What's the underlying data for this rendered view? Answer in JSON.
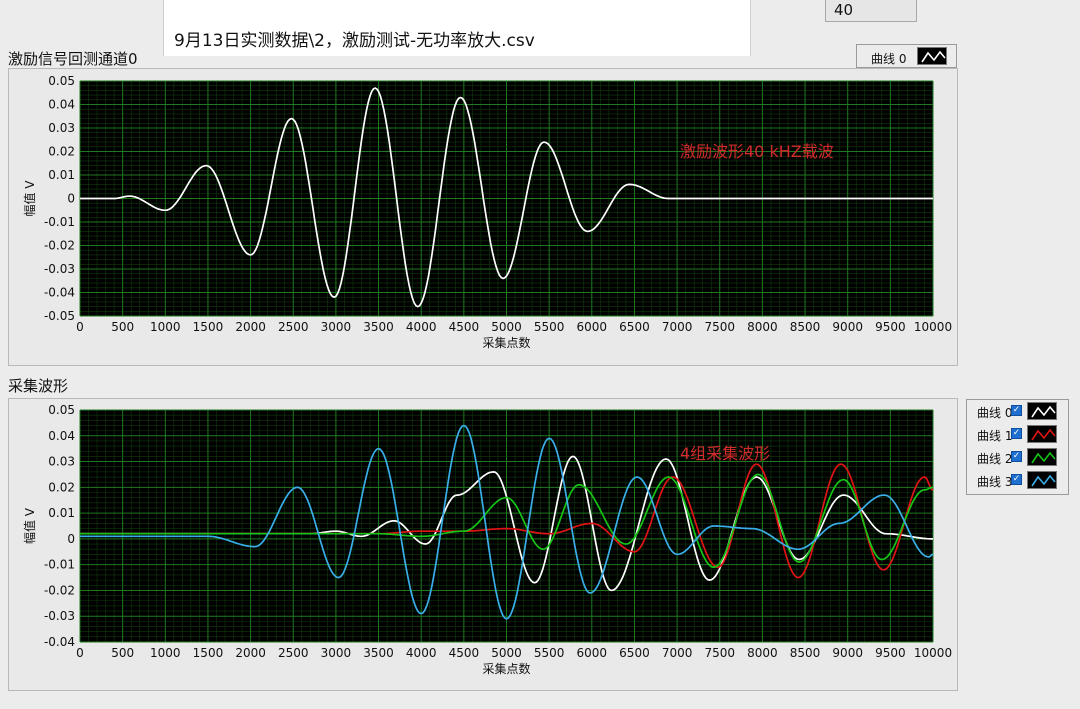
{
  "file_path": {
    "text": "9月13日实测数据\\2，激励测试-无功率放大.csv"
  },
  "numeric_control": {
    "value": "40"
  },
  "graph1": {
    "title": "激励信号回测通道0",
    "legend": [
      {
        "label": "曲线 0",
        "color": "#ffffff"
      }
    ],
    "annotation": "激励波形40 kHZ载波",
    "annotation_color": "#d22b2b"
  },
  "graph2": {
    "title": "采集波形",
    "legend": [
      {
        "label": "曲线 0",
        "color": "#ffffff"
      },
      {
        "label": "曲线 1",
        "color": "#e01414"
      },
      {
        "label": "曲线 2",
        "color": "#16c416"
      },
      {
        "label": "曲线 3",
        "color": "#3aaee8"
      }
    ],
    "annotation": "4组采集波形",
    "annotation_color": "#d22b2b"
  },
  "chart_data": [
    {
      "type": "line",
      "title": "激励信号回测通道0",
      "xlabel": "采集点数",
      "ylabel": "幅值 V",
      "xlim": [
        0,
        10000
      ],
      "ylim": [
        -0.05,
        0.05
      ],
      "x_ticks": [
        0,
        500,
        1000,
        1500,
        2000,
        2500,
        3000,
        3500,
        4000,
        4500,
        5000,
        5500,
        6000,
        6500,
        7000,
        7500,
        8000,
        8500,
        9000,
        9500,
        10000
      ],
      "y_ticks": [
        "0.05",
        "0.04",
        "0.03",
        "0.02",
        "0.01",
        "0",
        "-0.01",
        "-0.02",
        "-0.03",
        "-0.04",
        "-0.05"
      ],
      "grid": true,
      "legend_position": "top-right",
      "series": [
        {
          "name": "曲线 0",
          "color": "#ffffff",
          "x": [
            0,
            400,
            580,
            1000,
            1480,
            2000,
            2480,
            2980,
            3460,
            3960,
            4460,
            4960,
            5440,
            5950,
            6440,
            6900,
            7100,
            10000
          ],
          "y": [
            0,
            0,
            0.001,
            -0.005,
            0.014,
            -0.024,
            0.034,
            -0.042,
            0.047,
            -0.046,
            0.043,
            -0.034,
            0.024,
            -0.014,
            0.006,
            0,
            0,
            0
          ]
        }
      ]
    },
    {
      "type": "line",
      "title": "采集波形",
      "xlabel": "采集点数",
      "ylabel": "幅值 V",
      "xlim": [
        0,
        10000
      ],
      "ylim": [
        -0.04,
        0.05
      ],
      "x_ticks": [
        0,
        500,
        1000,
        1500,
        2000,
        2500,
        3000,
        3500,
        4000,
        4500,
        5000,
        5500,
        6000,
        6500,
        7000,
        7500,
        8000,
        8500,
        9000,
        9500,
        10000
      ],
      "y_ticks": [
        "0.05",
        "0.04",
        "0.03",
        "0.02",
        "0.01",
        "0",
        "-0.01",
        "-0.02",
        "-0.03",
        "-0.04"
      ],
      "grid": true,
      "legend_position": "right",
      "series": [
        {
          "name": "曲线 0",
          "color": "#ffffff",
          "x": [
            0,
            2000,
            2700,
            3000,
            3300,
            3680,
            4050,
            4420,
            4850,
            5330,
            5780,
            6230,
            6870,
            7380,
            7930,
            8430,
            8950,
            9450,
            10000
          ],
          "y": [
            0.002,
            0.002,
            0.002,
            0.003,
            0.001,
            0.007,
            -0.002,
            0.017,
            0.026,
            -0.017,
            0.032,
            -0.02,
            0.031,
            -0.016,
            0.024,
            -0.008,
            0.017,
            0.002,
            0
          ]
        },
        {
          "name": "曲线 1",
          "color": "#e01414",
          "x": [
            0,
            3500,
            4000,
            4500,
            5000,
            5500,
            6000,
            6500,
            6950,
            7480,
            7930,
            8420,
            8920,
            9420,
            9900,
            10000
          ],
          "y": [
            0.002,
            0.002,
            0.003,
            0.003,
            0.004,
            0.002,
            0.006,
            -0.005,
            0.024,
            -0.011,
            0.029,
            -0.015,
            0.029,
            -0.012,
            0.024,
            0.019
          ]
        },
        {
          "name": "曲线 2",
          "color": "#16c416",
          "x": [
            0,
            3500,
            4000,
            4500,
            5000,
            5430,
            5850,
            6400,
            6900,
            7430,
            7950,
            8430,
            8950,
            9400,
            9900,
            10000
          ],
          "y": [
            0.002,
            0.002,
            0.001,
            0.003,
            0.016,
            -0.004,
            0.021,
            -0.002,
            0.024,
            -0.011,
            0.025,
            -0.009,
            0.023,
            -0.008,
            0.019,
            0.02
          ]
        },
        {
          "name": "曲线 3",
          "color": "#3aaee8",
          "x": [
            0,
            1500,
            2050,
            2550,
            3030,
            3500,
            4000,
            4500,
            5000,
            5500,
            5980,
            6530,
            7000,
            7430,
            7880,
            8420,
            8900,
            9430,
            9950,
            10000
          ],
          "y": [
            0.001,
            0.001,
            -0.003,
            0.02,
            -0.015,
            0.035,
            -0.029,
            0.044,
            -0.031,
            0.039,
            -0.021,
            0.024,
            -0.006,
            0.005,
            0.004,
            -0.004,
            0.006,
            0.017,
            -0.007,
            -0.006
          ]
        }
      ]
    }
  ]
}
